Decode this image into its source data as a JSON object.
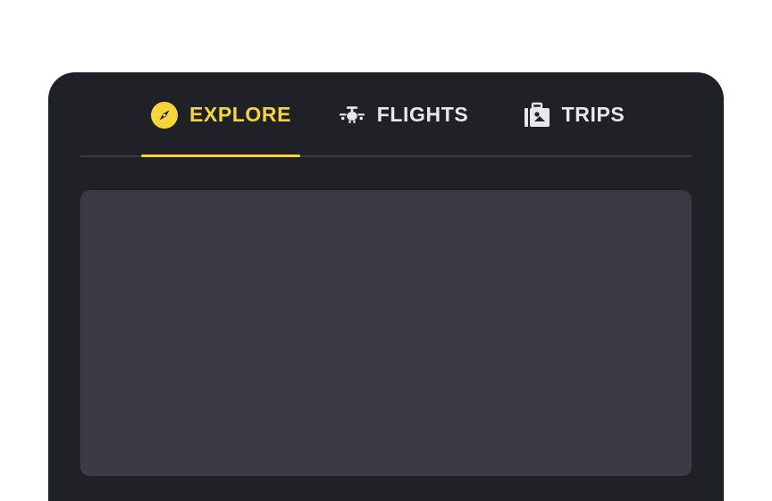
{
  "tabs": [
    {
      "label": "EXPLORE",
      "icon": "compass-icon",
      "active": true
    },
    {
      "label": "FLIGHTS",
      "icon": "plane-icon",
      "active": false
    },
    {
      "label": "TRIPS",
      "icon": "luggage-icon",
      "active": false
    }
  ],
  "colors": {
    "accent": "#f6d53a",
    "card_background": "#202127",
    "panel_background": "#3b3b44",
    "inactive_text": "#e8e8ec"
  }
}
